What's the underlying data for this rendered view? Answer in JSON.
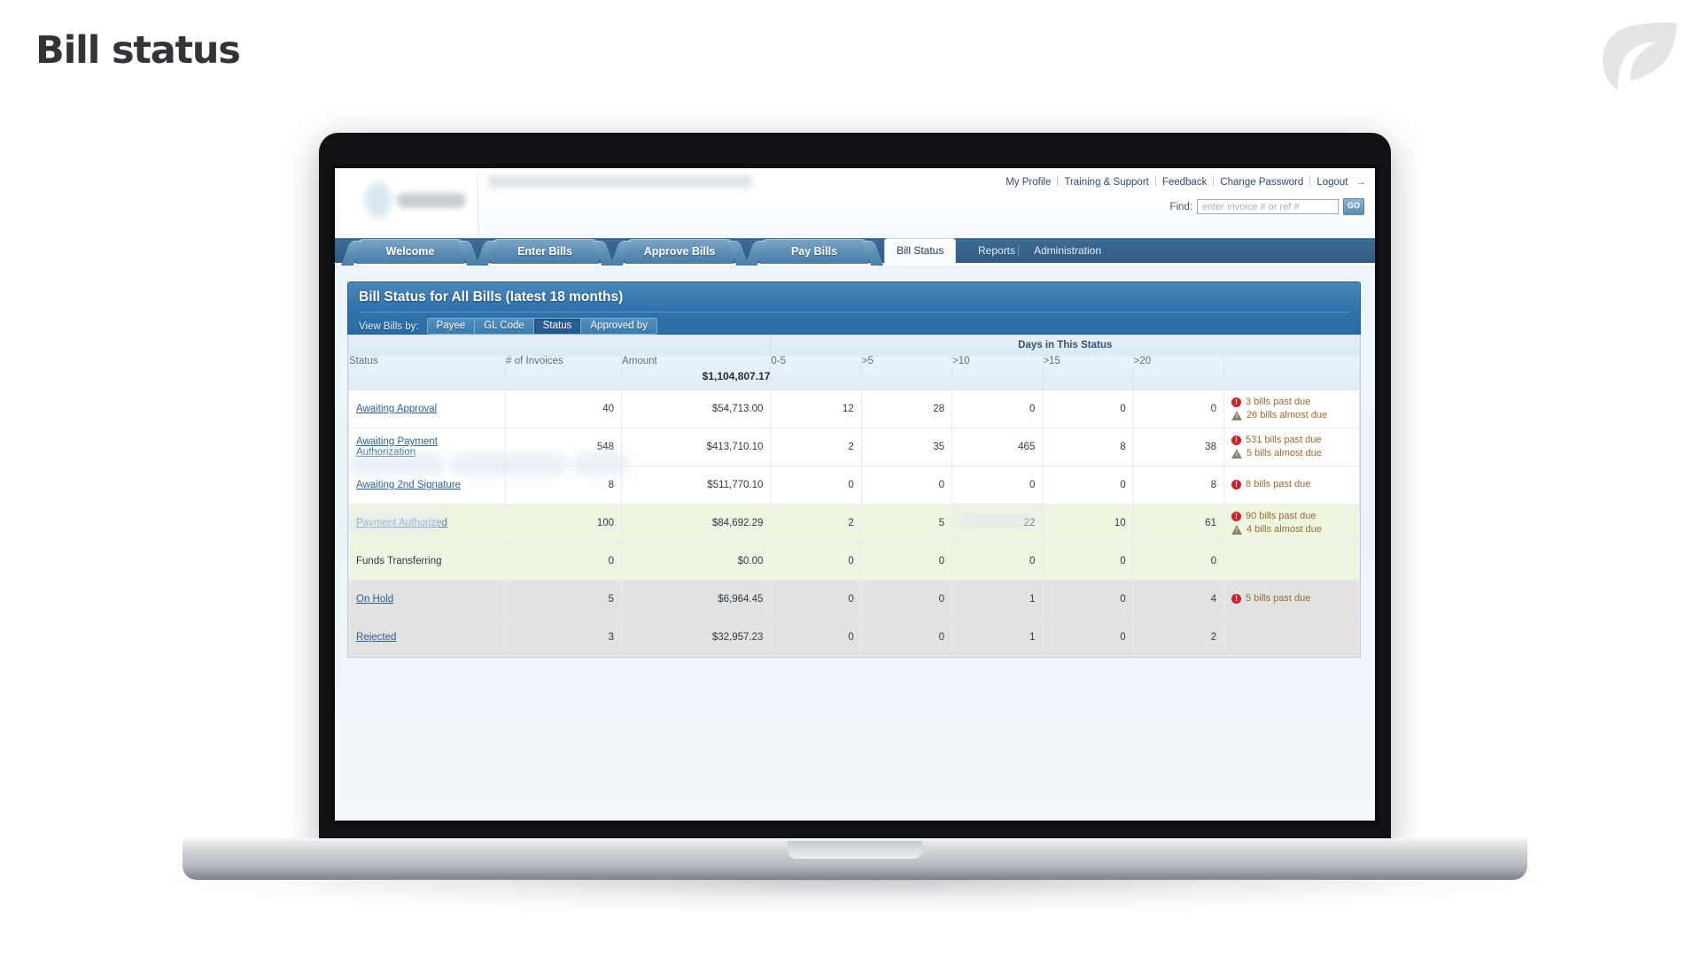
{
  "slide": {
    "title": "Bill status",
    "logo_icon": "leaf-logo-icon"
  },
  "app": {
    "util_nav": [
      {
        "label": "My Profile"
      },
      {
        "label": "Training & Support"
      },
      {
        "label": "Feedback"
      },
      {
        "label": "Change Password"
      },
      {
        "label": "Logout"
      }
    ],
    "logout_arrow": "→",
    "find": {
      "label": "Find:",
      "placeholder": "enter invoice # or ref #",
      "value": "",
      "go_label": "GO"
    },
    "main_tabs": [
      {
        "label": "Welcome",
        "style": "shaped",
        "active": false
      },
      {
        "label": "Enter Bills",
        "style": "shaped",
        "active": false
      },
      {
        "label": "Approve Bills",
        "style": "shaped",
        "active": false
      },
      {
        "label": "Pay Bills",
        "style": "shaped",
        "active": false
      },
      {
        "label": "Bill Status",
        "style": "plain",
        "active": true
      },
      {
        "label": "Reports",
        "style": "plain",
        "active": false
      },
      {
        "label": "Administration",
        "style": "plain",
        "active": false
      }
    ]
  },
  "panel": {
    "title": "Bill Status for All Bills  (latest 18 months)",
    "viewby_label": "View Bills by:",
    "viewby_buttons": [
      {
        "label": "Payee",
        "active": false
      },
      {
        "label": "GL Code",
        "active": false
      },
      {
        "label": "Status",
        "active": true
      },
      {
        "label": "Approved by",
        "active": false
      }
    ]
  },
  "table": {
    "group_header": "Days in This Status",
    "columns": [
      {
        "key": "status",
        "label": "Status"
      },
      {
        "key": "invoices",
        "label": "# of Invoices"
      },
      {
        "key": "amount",
        "label": "Amount"
      },
      {
        "key": "d0_5",
        "label": "0-5"
      },
      {
        "key": "d5",
        "label": ">5"
      },
      {
        "key": "d10",
        "label": ">10"
      },
      {
        "key": "d15",
        "label": ">15"
      },
      {
        "key": "d20",
        "label": ">20"
      },
      {
        "key": "alerts",
        "label": ""
      }
    ],
    "total_amount": "$1,104,807.17",
    "rows": [
      {
        "status": "Awaiting Approval",
        "is_link": true,
        "tone": "white",
        "invoices": "40",
        "amount": "$54,713.00",
        "d0_5": "12",
        "d5": "28",
        "d10": "0",
        "d15": "0",
        "d20": "0",
        "alerts": [
          {
            "icon": "alert-circle-icon",
            "text": "3 bills past due"
          },
          {
            "icon": "warning-triangle-icon",
            "text": "26 bills almost due"
          }
        ]
      },
      {
        "status": "Awaiting Payment Authorization",
        "is_link": true,
        "tone": "white",
        "invoices": "548",
        "amount": "$413,710.10",
        "d0_5": "2",
        "d5": "35",
        "d10": "465",
        "d15": "8",
        "d20": "38",
        "alerts": [
          {
            "icon": "alert-circle-icon",
            "text": "531 bills past due"
          },
          {
            "icon": "warning-triangle-icon",
            "text": "5 bills almost due"
          }
        ]
      },
      {
        "status": "Awaiting 2nd Signature",
        "is_link": true,
        "tone": "white",
        "invoices": "8",
        "amount": "$511,770.10",
        "d0_5": "0",
        "d5": "0",
        "d10": "0",
        "d15": "0",
        "d20": "8",
        "alerts": [
          {
            "icon": "alert-circle-icon",
            "text": "8 bills past due"
          }
        ]
      },
      {
        "status": "Payment Authorized",
        "is_link": true,
        "tone": "green",
        "invoices": "100",
        "amount": "$84,692.29",
        "d0_5": "2",
        "d5": "5",
        "d10": "22",
        "d15": "10",
        "d20": "61",
        "alerts": [
          {
            "icon": "alert-circle-icon",
            "text": "90 bills past due"
          },
          {
            "icon": "warning-triangle-icon",
            "text": "4 bills almost due"
          }
        ]
      },
      {
        "status": "Funds Transferring",
        "is_link": false,
        "tone": "green",
        "invoices": "0",
        "amount": "$0.00",
        "d0_5": "0",
        "d5": "0",
        "d10": "0",
        "d15": "0",
        "d20": "0",
        "alerts": []
      },
      {
        "status": "On Hold",
        "is_link": true,
        "tone": "grey",
        "invoices": "5",
        "amount": "$6,964.45",
        "d0_5": "0",
        "d5": "0",
        "d10": "1",
        "d15": "0",
        "d20": "4",
        "alerts": [
          {
            "icon": "alert-circle-icon",
            "text": "5 bills past due"
          }
        ]
      },
      {
        "status": "Rejected",
        "is_link": true,
        "tone": "grey",
        "invoices": "3",
        "amount": "$32,957.23",
        "d0_5": "0",
        "d5": "0",
        "d10": "1",
        "d15": "0",
        "d20": "2",
        "alerts": []
      }
    ]
  },
  "colors": {
    "slide_title": "#333438",
    "panel_header_blue": "#2f72ab",
    "tab_blue": "#5e8db4",
    "link_blue": "#2d5f93",
    "alert_red": "#cf2026",
    "alert_text": "#9a6a33",
    "row_green": "#eef5e0",
    "row_grey": "#e2e2e2"
  }
}
